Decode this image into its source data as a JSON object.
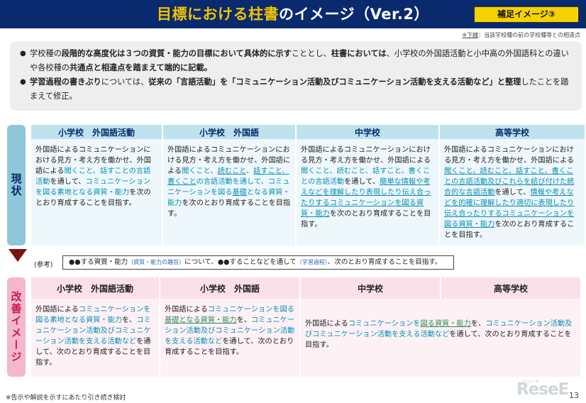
{
  "header": {
    "title_highlight": "目標における柱書",
    "title_rest": "のイメージ（Ver.2）",
    "badge": "補足イメージ③"
  },
  "note_top": {
    "label": "※下線",
    "text": "：当該学校種の前の学校種等との相違点"
  },
  "summary": {
    "b1": [
      {
        "t": "学校種の",
        "b": false
      },
      {
        "t": "段階的な高度化は３つの資質・能力の目標において具体的に示す",
        "b": true
      },
      {
        "t": "こととし、",
        "b": false
      },
      {
        "t": "柱書においては",
        "b": true
      },
      {
        "t": "、小学校の外国語活動と小中高の外国語科との違いや各校種の",
        "b": false
      },
      {
        "t": "共通点と相違点を踏まえて端的に記載。",
        "b": true
      }
    ],
    "b2": [
      {
        "t": "学習過程の書きぶり",
        "b": true
      },
      {
        "t": "については、",
        "b": false
      },
      {
        "t": "従来の「言語活動」を「コミュニケーション活動及びコミュニケーション活動を支える活動など」と整理",
        "b": true
      },
      {
        "t": "したことを踏まえて修正。",
        "b": false
      }
    ]
  },
  "side": {
    "now": "現状",
    "kaizen": "改善イメージ"
  },
  "now_table": {
    "headers": [
      "小学校　外国語活動",
      "小学校　外国語",
      "中学校",
      "高等学校"
    ],
    "cells": [
      [
        {
          "t": "外国語によるコミュニケーションにおける見方・考え方を働かせ、外国語による",
          "c": ""
        },
        {
          "t": "聞くこと、話すことの言語活動",
          "c": "cyan"
        },
        {
          "t": "を通して、",
          "c": ""
        },
        {
          "t": "コミュニケーションを図る素地となる資質・能力",
          "c": "cyan"
        },
        {
          "t": "を次のとおり育成することを目指す。",
          "c": ""
        }
      ],
      [
        {
          "t": "外国語によるコミュニケーションにおける見方・考え方を働かせ、外国語による",
          "c": ""
        },
        {
          "t": "聞くこと、",
          "c": "cyan"
        },
        {
          "t": "読むこと",
          "c": "cyan ul"
        },
        {
          "t": "、",
          "c": "cyan"
        },
        {
          "t": "話すこと、書くこと",
          "c": "cyan ul"
        },
        {
          "t": "の言語活動を通して、コミュニケーションを図る",
          "c": "cyan"
        },
        {
          "t": "基礎",
          "c": "cyan ul"
        },
        {
          "t": "となる資質・能力",
          "c": "cyan"
        },
        {
          "t": "を次のとおり育成することを目指す。",
          "c": ""
        }
      ],
      [
        {
          "t": "外国語によるコミュニケーションにおける見方・考え方を働かせ、外国語による",
          "c": ""
        },
        {
          "t": "聞くこと、読むこと、話すこと、書くことの言語活動",
          "c": "cyan"
        },
        {
          "t": "を通して、",
          "c": ""
        },
        {
          "t": "簡単な情報や考えなどを理解したり表現したり伝え合ったりするコミュニケーションを図る資質・能力",
          "c": "cyan ul"
        },
        {
          "t": "を次のとおり育成することを目指す。",
          "c": ""
        }
      ],
      [
        {
          "t": "外国語によるコミュニケーションにおける見方・考え方を働かせ、外国語による",
          "c": ""
        },
        {
          "t": "聞くこと、読むこと、話すこと、書くことの言語活動及びこれらを結び付けた統合的な言語活動",
          "c": "cyan ul"
        },
        {
          "t": "を通して、",
          "c": ""
        },
        {
          "t": "情報や考えなどを的確に理解したり適切に表現したり伝え合ったりするコミュニケーションを図る資質・能力",
          "c": "cyan ul"
        },
        {
          "t": "を次のとおり育成することを目指す。",
          "c": ""
        }
      ]
    ]
  },
  "reference": {
    "label": "(参考)",
    "p1": "●●する資質・能力",
    "p2": "（資質・能力の趣旨）",
    "p3": "について、●●することなどを通して",
    "p4": "（学習過程）",
    "p5": "、次のとおり育成することを目指す。"
  },
  "kaizen_table": {
    "headers": [
      "小学校　外国語活動",
      "小学校　外国語",
      "中学校",
      "高等学校"
    ],
    "cells": [
      [
        {
          "t": "外国語による",
          "c": ""
        },
        {
          "t": "コミュニケーションを図る素地となる資質・能力",
          "c": "cyan"
        },
        {
          "t": "を、",
          "c": ""
        },
        {
          "t": "コミュニケーション活動及びコミュニケーション活動を支える活動など",
          "c": "cyan"
        },
        {
          "t": "を通して、次のとおり育成することを目指す。",
          "c": ""
        }
      ],
      [
        {
          "t": "外国語による",
          "c": ""
        },
        {
          "t": "コミュニケーションを図る",
          "c": "cyan"
        },
        {
          "t": "基礎となる資質・能力",
          "c": "green ul"
        },
        {
          "t": "を、",
          "c": ""
        },
        {
          "t": "コミュニケーション活動及びコミュニケーション活動を支える活動など",
          "c": "cyan"
        },
        {
          "t": "を通して、次のとおり育成することを目指す。",
          "c": ""
        }
      ],
      [
        {
          "t": "外国語による",
          "c": ""
        },
        {
          "t": "コミュニケーションを",
          "c": "cyan"
        },
        {
          "t": "図る資質・能力",
          "c": "green ul"
        },
        {
          "t": "を、",
          "c": ""
        },
        {
          "t": "コミュニケーション活動及びコミュニケーション活動を支える活動など",
          "c": "cyan"
        },
        {
          "t": "を通して、次のとおり育成することを目指す。",
          "c": ""
        }
      ]
    ]
  },
  "footer": "※告示や解説を示すにあたり引き続き検討",
  "logo": "ReseE",
  "logo_small": "リシード",
  "page_number": "13"
}
